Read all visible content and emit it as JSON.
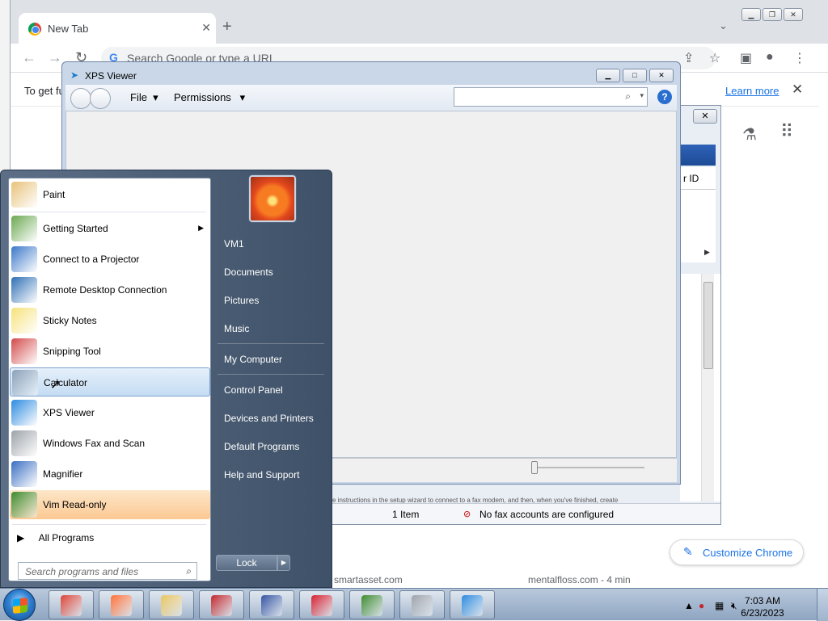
{
  "chrome": {
    "tab_title": "New Tab",
    "tab_close": "✕",
    "new_tab": "+",
    "tab_search": "⌄",
    "omnibox_g": "G",
    "omnibox_placeholder": "Search Google or type a URL",
    "infobar_text": "To get fu",
    "learn_more": "Learn more",
    "infobar_close": "✕",
    "customize_label": "Customize Chrome",
    "shortcut_1": "smartasset.com",
    "shortcut_2": "mentalfloss.com - 4 min"
  },
  "fax": {
    "col_header": "r ID",
    "items_count": "1 Item",
    "no_fax": "No fax accounts are configured",
    "info_line": "e instructions in the setup wizard to connect to a fax modem, and then, when you've finished, create"
  },
  "xps": {
    "title": "XPS Viewer",
    "menu_file": "File",
    "menu_permissions": "Permissions",
    "help": "?"
  },
  "startmenu": {
    "programs": [
      {
        "label": "Paint",
        "icon": "paint-icon",
        "color": "#e8c27a"
      },
      {
        "label": "Getting Started",
        "icon": "getting-started-icon",
        "color": "#6aa84f",
        "submenu": true
      },
      {
        "label": "Connect to a Projector",
        "icon": "projector-icon",
        "color": "#3b78c9"
      },
      {
        "label": "Remote Desktop Connection",
        "icon": "remote-desktop-icon",
        "color": "#2f6fb5"
      },
      {
        "label": "Sticky Notes",
        "icon": "sticky-notes-icon",
        "color": "#f6e27a"
      },
      {
        "label": "Snipping Tool",
        "icon": "snipping-tool-icon",
        "color": "#d24a4a"
      },
      {
        "label": "Calculator",
        "icon": "calculator-icon",
        "color": "#8aa0b8",
        "hover": true
      },
      {
        "label": "XPS Viewer",
        "icon": "xps-viewer-icon",
        "color": "#2c8be0"
      },
      {
        "label": "Windows Fax and Scan",
        "icon": "fax-scan-icon",
        "color": "#9da3aa"
      },
      {
        "label": "Magnifier",
        "icon": "magnifier-icon",
        "color": "#3a6fc2"
      },
      {
        "label": "Vim Read-only",
        "icon": "vim-icon",
        "color": "#3c8a2e",
        "pinned": true
      }
    ],
    "all_programs": "All Programs",
    "search_placeholder": "Search programs and files",
    "right_items": [
      "VM1",
      "Documents",
      "Pictures",
      "Music",
      "My Computer",
      "Control Panel",
      "Devices and Printers",
      "Default Programs",
      "Help and Support"
    ],
    "lock_label": "Lock"
  },
  "taskbar": {
    "apps": [
      {
        "name": "chrome-taskbar-button",
        "icon": "chrome-icon",
        "color": "#db4437"
      },
      {
        "name": "firefox-taskbar-button",
        "icon": "firefox-icon",
        "color": "#ff7139"
      },
      {
        "name": "explorer-taskbar-button",
        "icon": "folder-icon",
        "color": "#e8c560"
      },
      {
        "name": "app-red-taskbar-button",
        "icon": "red-app-icon",
        "color": "#c0282d"
      },
      {
        "name": "app-blue-taskbar-button",
        "icon": "blue-app-icon",
        "color": "#3353a3"
      },
      {
        "name": "recorder-taskbar-button",
        "icon": "recorder-icon",
        "color": "#d62030"
      },
      {
        "name": "vim-taskbar-button",
        "icon": "vim-icon",
        "color": "#3c8a2e"
      },
      {
        "name": "fax-taskbar-button",
        "icon": "fax-scan-icon",
        "color": "#9da3aa"
      },
      {
        "name": "xps-taskbar-button",
        "icon": "xps-viewer-icon",
        "color": "#2c8be0"
      }
    ],
    "time": "7:03 AM",
    "date": "6/23/2023"
  }
}
